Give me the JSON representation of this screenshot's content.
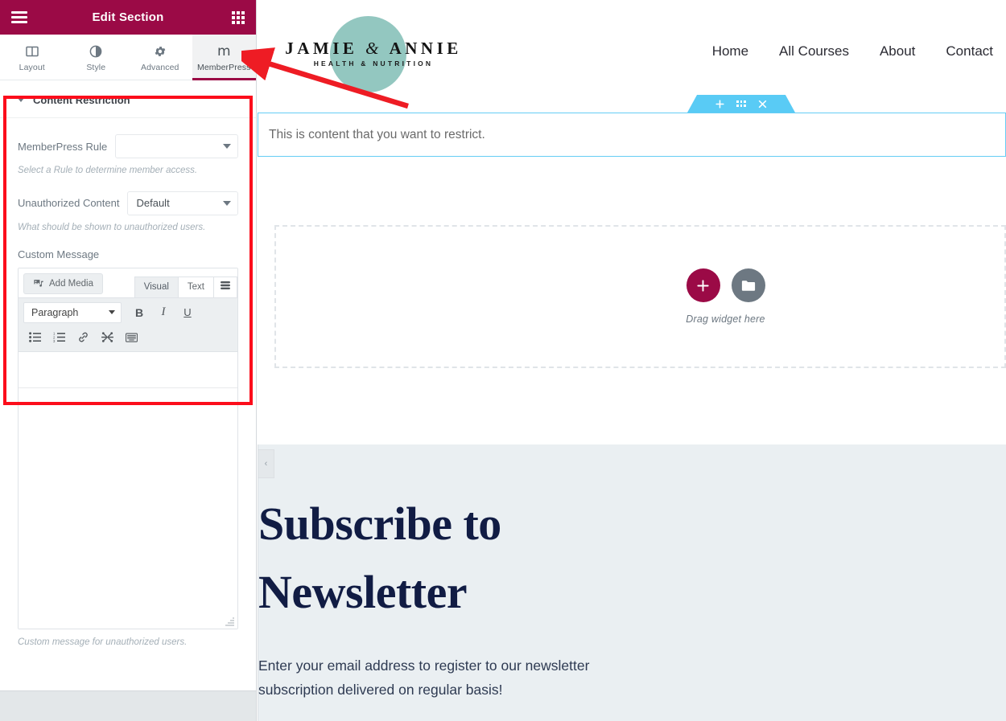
{
  "panel": {
    "header": {
      "title": "Edit Section",
      "menu_icon": "hamburger-icon",
      "apps_icon": "grid-apps-icon",
      "bg_color": "#9b0a46"
    },
    "tabs": [
      {
        "label": "Layout",
        "icon": "layout-columns-icon",
        "active": false
      },
      {
        "label": "Style",
        "icon": "contrast-circle-icon",
        "active": false
      },
      {
        "label": "Advanced",
        "icon": "gear-icon",
        "active": false
      },
      {
        "label": "MemberPress",
        "icon": "memberpress-m-icon",
        "active": true
      }
    ],
    "section": {
      "title": "Content Restriction",
      "collapse_icon": "caret-down-icon"
    },
    "controls": {
      "rule_label": "MemberPress Rule",
      "rule_value": "",
      "rule_description": "Select a Rule to determine member access.",
      "unauthorized_label": "Unauthorized Content",
      "unauthorized_value": "Default",
      "unauthorized_description": "What should be shown to unauthorized users.",
      "custom_message_label": "Custom Message",
      "custom_message_value": "",
      "custom_message_description": "Custom message for unauthorized users."
    },
    "editor": {
      "add_media_label": "Add Media",
      "add_media_icon": "media-photo-music-icon",
      "mode_tabs": [
        {
          "label": "Visual",
          "active": true
        },
        {
          "label": "Text",
          "active": false
        }
      ],
      "toolbar_toggle_icon": "toolbar-toggle-icon",
      "format_select_value": "Paragraph",
      "buttons_row1": [
        {
          "label": "B",
          "name": "bold-button"
        },
        {
          "label": "I",
          "name": "italic-button"
        },
        {
          "label": "U",
          "name": "underline-button"
        }
      ],
      "buttons_row2": [
        {
          "name": "bullet-list-icon"
        },
        {
          "name": "numbered-list-icon"
        },
        {
          "name": "link-icon"
        },
        {
          "name": "read-more-icon"
        },
        {
          "name": "keyboard-shortcuts-icon"
        }
      ]
    }
  },
  "preview": {
    "logo": {
      "brand_part1": "JAMIE",
      "brand_amp": "&",
      "brand_part2": "ANNIE",
      "tagline": "HEALTH & NUTRITION",
      "circle_color": "#93c7c0"
    },
    "nav": [
      {
        "label": "Home"
      },
      {
        "label": "All Courses"
      },
      {
        "label": "About"
      },
      {
        "label": "Contact"
      }
    ],
    "section_toolbar": {
      "add_icon": "plus-icon",
      "handle_icon": "six-dots-handle-icon",
      "close_icon": "close-x-icon",
      "color": "#59cbf5"
    },
    "content_widget": {
      "text": "This is content that you want to restrict."
    },
    "drag_zone": {
      "add_icon": "plus-icon",
      "folder_icon": "folder-icon",
      "hint": "Drag widget here",
      "add_color": "#9b0a46",
      "folder_color": "#6d7882"
    },
    "newsletter": {
      "collapse_icon": "chevron-left-icon",
      "heading_line1": "Subscribe to",
      "heading_line2": "Newsletter",
      "body_line1": "Enter your email address to register to our newsletter",
      "body_line2": "subscription delivered on regular basis!"
    }
  },
  "annotation": {
    "box_color": "#fc0d1b",
    "arrow_color": "#ee1c24",
    "arrow_target": "MemberPress tab"
  }
}
